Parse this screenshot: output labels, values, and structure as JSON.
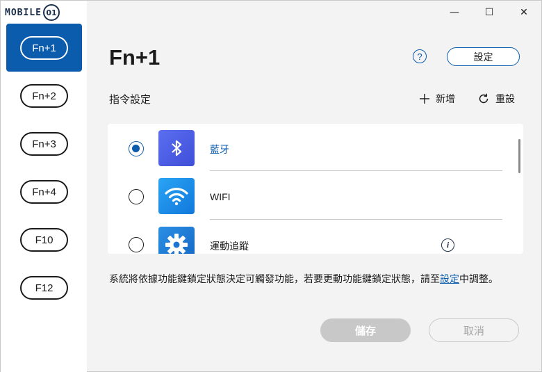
{
  "app": {
    "logo_text": "MOBILE",
    "logo_badge": "01"
  },
  "window_controls": {
    "minimize": "—",
    "maximize": "☐",
    "close": "✕"
  },
  "sidebar": {
    "items": [
      {
        "label": "Fn+1",
        "active": true
      },
      {
        "label": "Fn+2",
        "active": false
      },
      {
        "label": "Fn+3",
        "active": false
      },
      {
        "label": "Fn+4",
        "active": false
      },
      {
        "label": "F10",
        "active": false
      },
      {
        "label": "F12",
        "active": false
      }
    ]
  },
  "header": {
    "title": "Fn+1",
    "help_glyph": "?",
    "settings_label": "設定"
  },
  "commands": {
    "section_title": "指令設定",
    "add_label": "新增",
    "reset_label": "重設",
    "items": [
      {
        "label": "藍牙",
        "icon": "bluetooth-icon",
        "selected": true,
        "icon_color": "#4a5ee8"
      },
      {
        "label": "WIFI",
        "icon": "wifi-icon",
        "selected": false,
        "icon_color": "#1d8fe8"
      },
      {
        "label": "運動追蹤",
        "icon": "gear-icon",
        "selected": false,
        "icon_color": "#1d7fd6",
        "info_glyph": "i"
      }
    ]
  },
  "note": {
    "text_before": "系統將依據功能鍵鎖定狀態決定可觸發功能，若要更動功能鍵鎖定狀態，請至",
    "link": "設定",
    "text_after": "中調整。"
  },
  "footer": {
    "save_label": "儲存",
    "cancel_label": "取消"
  },
  "colors": {
    "accent": "#0b5cad",
    "disabled": "#c8c8c8"
  }
}
